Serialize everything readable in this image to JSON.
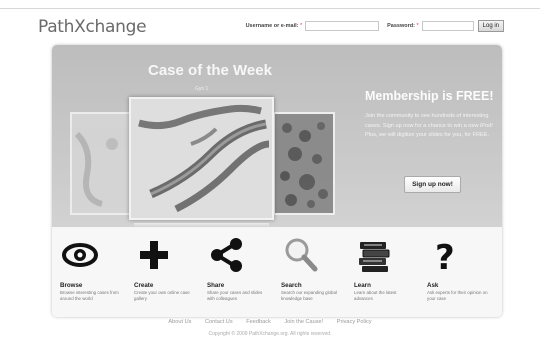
{
  "header": {
    "logo": "PathXchange",
    "username_label": "Username or e-mail:",
    "password_label": "Password:",
    "required_mark": "*",
    "login_button": "Log in"
  },
  "hero": {
    "case_title": "Case of the Week",
    "case_caption": "Gyn 1",
    "membership_title": "Membership is FREE!",
    "membership_text": "Join the community to see hundreds of interesting cases. Sign up now for a chance to win a new iPod! Plus, we will digitize your slides for you, for FREE.",
    "signup_button": "Sign up now!"
  },
  "features": [
    {
      "icon": "eye-icon",
      "title": "Browse",
      "desc": "Browse interesting cases from around the world"
    },
    {
      "icon": "plus-icon",
      "title": "Create",
      "desc": "Create your own online case gallery"
    },
    {
      "icon": "share-icon",
      "title": "Share",
      "desc": "Share your cases and slides with colleagues"
    },
    {
      "icon": "magnifier-icon",
      "title": "Search",
      "desc": "Search our expanding global knowledge base"
    },
    {
      "icon": "books-icon",
      "title": "Learn",
      "desc": "Learn about the latest advances"
    },
    {
      "icon": "question-icon",
      "title": "Ask",
      "desc": "Ask experts for their opinion on your case"
    }
  ],
  "footer": {
    "links": [
      "About Us",
      "Contact Us",
      "Feedback",
      "Join the Cause!",
      "Privacy Policy"
    ],
    "copyright": "Copyright © 2009 PathXchange.org. All rights reserved."
  }
}
